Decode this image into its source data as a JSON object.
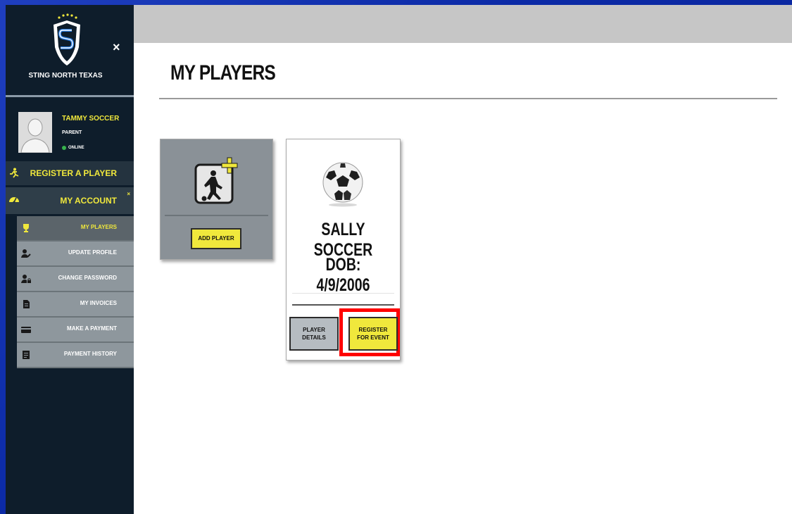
{
  "sidebar": {
    "org_name": "STING NORTH TEXAS",
    "close_label": "×",
    "user": {
      "name": "TAMMY SOCCER",
      "role": "PARENT",
      "status": "ONLINE"
    },
    "register_label": "REGISTER A PLAYER",
    "account_label": "MY ACCOUNT",
    "account_caret": "×",
    "items": [
      {
        "label": "MY PLAYERS",
        "icon": "trophy-icon",
        "active": true
      },
      {
        "label": "UPDATE PROFILE",
        "icon": "user-edit-icon"
      },
      {
        "label": "CHANGE PASSWORD",
        "icon": "user-lock-icon"
      },
      {
        "label": "MY INVOICES",
        "icon": "invoice-icon"
      },
      {
        "label": "MAKE A PAYMENT",
        "icon": "credit-card-icon"
      },
      {
        "label": "PAYMENT HISTORY",
        "icon": "history-icon"
      }
    ]
  },
  "main": {
    "title": "MY PLAYERS",
    "add_card": {
      "button_label": "ADD PLAYER"
    },
    "player": {
      "name": "SALLY SOCCER",
      "dob": "DOB: 4/9/2006",
      "details_label": "PLAYER DETAILS",
      "register_label": "REGISTER FOR EVENT"
    }
  },
  "colors": {
    "accent": "#f0e83c",
    "sidebar": "#0e1d2b",
    "highlight": "#ff0000"
  }
}
